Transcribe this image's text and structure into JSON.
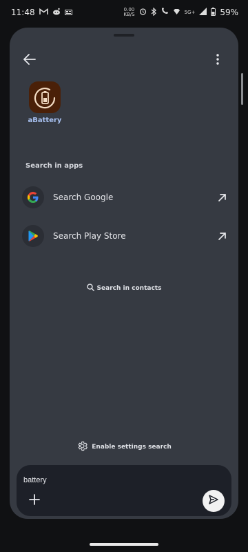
{
  "status_bar": {
    "time": "11:48",
    "gmail_icon": "gmail-icon",
    "reddit_icon": "reddit-icon",
    "news_icon": "news-icon",
    "data_speed_value": "0.00",
    "data_speed_unit": "KB/S",
    "network_type": "5G+",
    "battery_percent": "59%"
  },
  "header": {
    "back_icon": "back-arrow-icon",
    "more_icon": "more-vert-icon"
  },
  "app_results": [
    {
      "label": "aBattery",
      "icon": "battery-app-icon"
    }
  ],
  "section_title": "Search in apps",
  "search_rows": [
    {
      "label": "Search Google",
      "icon": "google-icon",
      "action_icon": "arrow-up-right-icon"
    },
    {
      "label": "Search Play Store",
      "icon": "play-store-icon",
      "action_icon": "arrow-up-right-icon"
    }
  ],
  "contacts_search": {
    "label": "Search in contacts",
    "icon": "search-icon"
  },
  "settings_search": {
    "label": "Enable settings search",
    "icon": "gear-icon"
  },
  "input": {
    "value": "battery"
  },
  "colors": {
    "sheet_background": "#363a42",
    "input_panel": "#1d2028",
    "app_label": "#a9c2f2",
    "app_icon_background": "#4a2008"
  }
}
